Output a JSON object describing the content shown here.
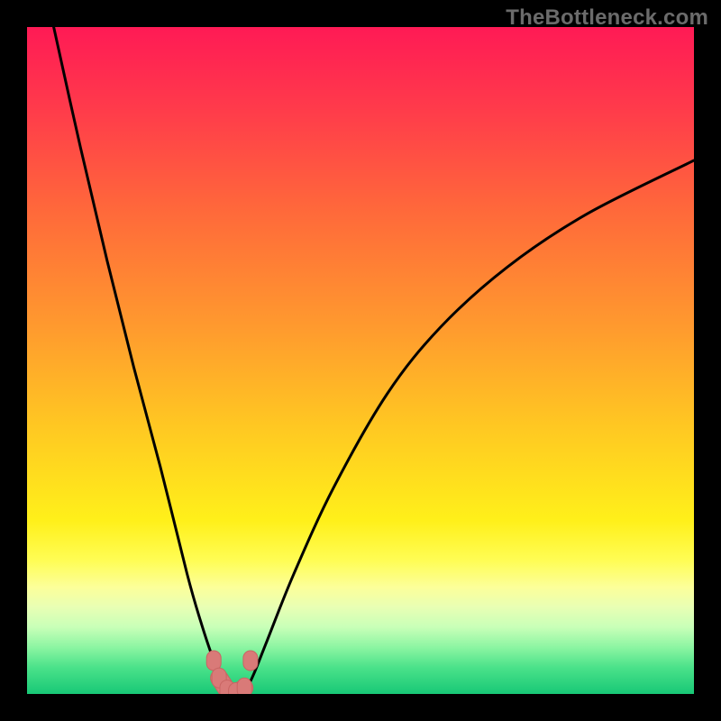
{
  "watermark": "TheBottleneck.com",
  "colors": {
    "frame": "#000000",
    "curve": "#000000",
    "marker_fill": "#d97a78",
    "marker_stroke": "#c96563",
    "gradient_stops": [
      {
        "offset": 0.0,
        "color": "#ff1a55"
      },
      {
        "offset": 0.12,
        "color": "#ff3a4b"
      },
      {
        "offset": 0.28,
        "color": "#ff6a3a"
      },
      {
        "offset": 0.45,
        "color": "#ff9a2e"
      },
      {
        "offset": 0.6,
        "color": "#ffc822"
      },
      {
        "offset": 0.74,
        "color": "#fff01a"
      },
      {
        "offset": 0.8,
        "color": "#fffd55"
      },
      {
        "offset": 0.84,
        "color": "#fcff9a"
      },
      {
        "offset": 0.87,
        "color": "#e8ffb4"
      },
      {
        "offset": 0.9,
        "color": "#c8ffb8"
      },
      {
        "offset": 0.93,
        "color": "#8cf5a2"
      },
      {
        "offset": 0.96,
        "color": "#4be28a"
      },
      {
        "offset": 1.0,
        "color": "#18c876"
      }
    ]
  },
  "chart_data": {
    "type": "line",
    "title": "",
    "xlabel": "",
    "ylabel": "",
    "xlim": [
      0,
      100
    ],
    "ylim": [
      0,
      100
    ],
    "note": "y is an estimated bottleneck-percentage-style metric vs x; minimum ≈ 0 near x≈29–33",
    "series": [
      {
        "name": "curve",
        "x": [
          4,
          8,
          12,
          16,
          20,
          24,
          26,
          28,
          29,
          30,
          31,
          32,
          33,
          34,
          36,
          40,
          46,
          54,
          62,
          72,
          84,
          100
        ],
        "y": [
          100,
          82,
          65,
          49,
          34,
          18,
          11,
          5,
          3,
          1,
          0,
          0,
          1,
          3,
          8,
          18,
          31,
          45,
          55,
          64,
          72,
          80
        ]
      }
    ],
    "markers": [
      {
        "x": 28.0,
        "y": 5.0
      },
      {
        "x": 33.5,
        "y": 5.0
      },
      {
        "x": 28.8,
        "y": 2.4
      },
      {
        "x": 30.0,
        "y": 0.6
      },
      {
        "x": 31.3,
        "y": 0.2
      },
      {
        "x": 32.6,
        "y": 0.9
      }
    ]
  }
}
